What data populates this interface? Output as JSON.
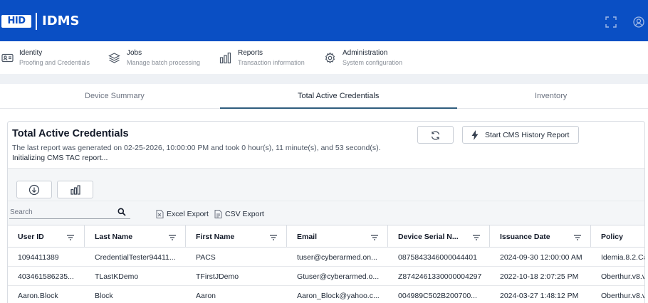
{
  "app": {
    "brand": "HID",
    "title": "IDMS"
  },
  "icons": {
    "expand": "expand-icon",
    "account": "user-account-icon"
  },
  "nav": [
    {
      "title": "Identity",
      "subtitle": "Proofing and Credentials",
      "icon": "id-card-icon"
    },
    {
      "title": "Jobs",
      "subtitle": "Manage batch processing",
      "icon": "layers-icon"
    },
    {
      "title": "Reports",
      "subtitle": "Transaction information",
      "icon": "bar-chart-icon"
    },
    {
      "title": "Administration",
      "subtitle": "System configuration",
      "icon": "gear-icon"
    }
  ],
  "tabs": [
    {
      "label": "Device Summary",
      "active": false
    },
    {
      "label": "Total Active Credentials",
      "active": true
    },
    {
      "label": "Inventory",
      "active": false
    }
  ],
  "panel": {
    "title": "Total Active Credentials",
    "description": "The last report was generated on 02-25-2026, 10:00:00 PM and took 0 hour(s), 11 minute(s), and 53 second(s).",
    "status": "Initializing CMS TAC report...",
    "cms_button": "Start CMS History Report"
  },
  "search": {
    "placeholder": "Search",
    "value": ""
  },
  "exports": {
    "excel": "Excel Export",
    "csv": "CSV Export"
  },
  "table": {
    "columns": [
      "User ID",
      "Last Name",
      "First Name",
      "Email",
      "Device Serial N...",
      "Issuance Date",
      "Policy"
    ],
    "rows": [
      [
        "1094411389",
        "CredentialTester94411...",
        "PACS",
        "tuser@cyberarmed.on...",
        "0875843346000044401",
        "2024-09-30 12:00:00 AM",
        "Idemia.8.2.Ca"
      ],
      [
        "403461586235...",
        "TLastKDemo",
        "TFirstJDemo",
        "Gtuser@cyberarmed.o...",
        "Z8742461330000004297",
        "2022-10-18 2:07:25 PM",
        "Oberthur.v8.v"
      ],
      [
        "Aaron.Block",
        "Block",
        "Aaron",
        "Aaron_Block@yahoo.c...",
        "004989C502B200700...",
        "2024-03-27 1:48:12 PM",
        "Oberthur.v8.v"
      ]
    ]
  },
  "colors": {
    "brand": "#0a4fc4",
    "tab_underline": "#2f5d7e"
  }
}
